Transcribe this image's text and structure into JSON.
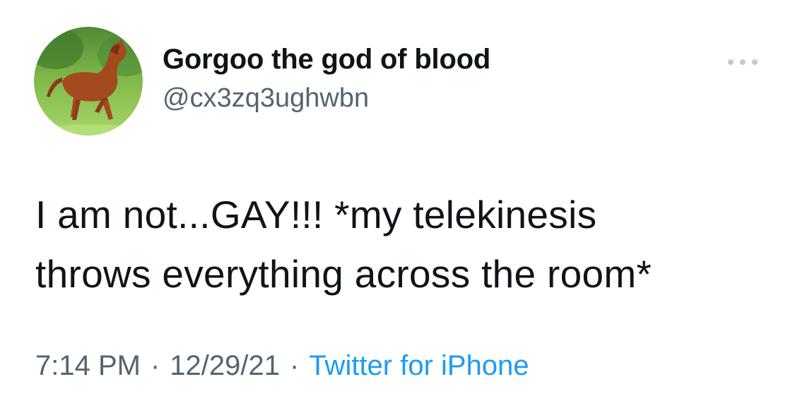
{
  "tweet": {
    "display_name": "Gorgoo the god of blood",
    "handle": "@cx3zq3ughwbn",
    "text": "I am not...GAY!!! *my telekinesis\nthrows everything across the room*",
    "time": "7:14 PM",
    "date": "12/29/21",
    "separator": "·",
    "source": "Twitter for iPhone"
  },
  "avatar": {
    "icon": "horse-avatar"
  },
  "colors": {
    "text": "#0f1419",
    "secondary": "#536471",
    "link": "#1d9bf0",
    "more_dots": "#c2cad1"
  }
}
